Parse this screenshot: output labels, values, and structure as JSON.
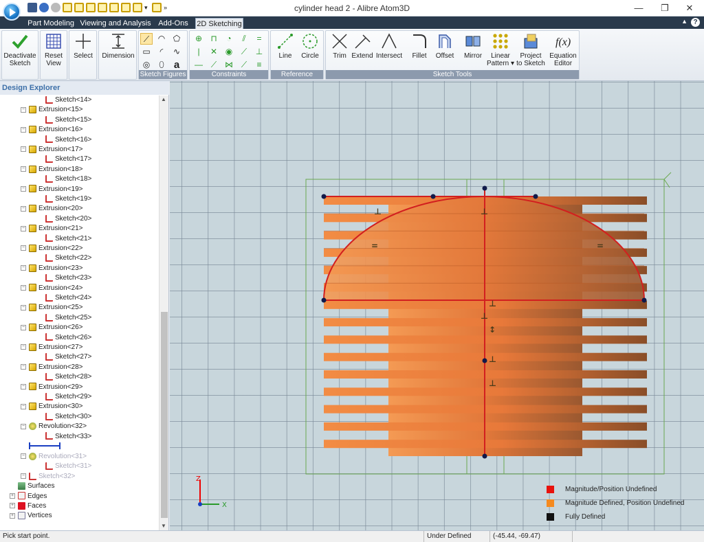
{
  "window": {
    "title": "cylinder head 2 - Alibre Atom3D",
    "minimize": "—",
    "maximize": "❐",
    "close": "✕"
  },
  "tabs": [
    {
      "label": "Part Modeling",
      "active": false
    },
    {
      "label": "Viewing and Analysis",
      "active": false
    },
    {
      "label": "Add-Ons",
      "active": false
    },
    {
      "label": "2D Sketching",
      "active": true
    }
  ],
  "ribbon": {
    "deactivate": {
      "line1": "Deactivate",
      "line2": "Sketch"
    },
    "reset_view": {
      "line1": "Reset",
      "line2": "View"
    },
    "select": {
      "label": "Select"
    },
    "dimension": {
      "label": "Dimension"
    },
    "sketch_figures_label": "Sketch Figures",
    "constraints_label": "Constraints",
    "line": {
      "label": "Line"
    },
    "circle": {
      "label": "Circle"
    },
    "reference_label": "Reference",
    "trim": {
      "label": "Trim"
    },
    "extend": {
      "label": "Extend"
    },
    "intersect": {
      "label": "Intersect"
    },
    "fillet": {
      "label": "Fillet"
    },
    "offset": {
      "label": "Offset"
    },
    "mirror": {
      "label": "Mirror"
    },
    "linear_pattern": {
      "line1": "Linear",
      "line2": "Pattern ▾"
    },
    "project": {
      "line1": "Project",
      "line2": "to Sketch"
    },
    "equation": {
      "line1": "Equation",
      "line2": "Editor"
    },
    "sketch_tools_label": "Sketch Tools"
  },
  "explorer": {
    "title": "Design Explorer",
    "items": [
      {
        "label": "Sketch<14>",
        "kind": "sketch",
        "state": "normal"
      },
      {
        "label": "Extrusion<15>",
        "kind": "extrusion",
        "state": "normal"
      },
      {
        "label": "Sketch<15>",
        "kind": "sketch",
        "state": "normal"
      },
      {
        "label": "Extrusion<16>",
        "kind": "extrusion",
        "state": "normal"
      },
      {
        "label": "Sketch<16>",
        "kind": "sketch",
        "state": "normal"
      },
      {
        "label": "Extrusion<17>",
        "kind": "extrusion",
        "state": "normal"
      },
      {
        "label": "Sketch<17>",
        "kind": "sketch",
        "state": "normal"
      },
      {
        "label": "Extrusion<18>",
        "kind": "extrusion",
        "state": "normal"
      },
      {
        "label": "Sketch<18>",
        "kind": "sketch",
        "state": "normal"
      },
      {
        "label": "Extrusion<19>",
        "kind": "extrusion",
        "state": "normal"
      },
      {
        "label": "Sketch<19>",
        "kind": "sketch",
        "state": "normal"
      },
      {
        "label": "Extrusion<20>",
        "kind": "extrusion",
        "state": "normal"
      },
      {
        "label": "Sketch<20>",
        "kind": "sketch",
        "state": "normal"
      },
      {
        "label": "Extrusion<21>",
        "kind": "extrusion",
        "state": "normal"
      },
      {
        "label": "Sketch<21>",
        "kind": "sketch",
        "state": "normal"
      },
      {
        "label": "Extrusion<22>",
        "kind": "extrusion",
        "state": "normal"
      },
      {
        "label": "Sketch<22>",
        "kind": "sketch",
        "state": "normal"
      },
      {
        "label": "Extrusion<23>",
        "kind": "extrusion",
        "state": "normal"
      },
      {
        "label": "Sketch<23>",
        "kind": "sketch",
        "state": "normal"
      },
      {
        "label": "Extrusion<24>",
        "kind": "extrusion",
        "state": "normal"
      },
      {
        "label": "Sketch<24>",
        "kind": "sketch",
        "state": "normal"
      },
      {
        "label": "Extrusion<25>",
        "kind": "extrusion",
        "state": "normal"
      },
      {
        "label": "Sketch<25>",
        "kind": "sketch",
        "state": "normal"
      },
      {
        "label": "Extrusion<26>",
        "kind": "extrusion",
        "state": "normal"
      },
      {
        "label": "Sketch<26>",
        "kind": "sketch",
        "state": "normal"
      },
      {
        "label": "Extrusion<27>",
        "kind": "extrusion",
        "state": "normal"
      },
      {
        "label": "Sketch<27>",
        "kind": "sketch",
        "state": "normal"
      },
      {
        "label": "Extrusion<28>",
        "kind": "extrusion",
        "state": "normal"
      },
      {
        "label": "Sketch<28>",
        "kind": "sketch",
        "state": "normal"
      },
      {
        "label": "Extrusion<29>",
        "kind": "extrusion",
        "state": "normal"
      },
      {
        "label": "Sketch<29>",
        "kind": "sketch",
        "state": "normal"
      },
      {
        "label": "Extrusion<30>",
        "kind": "extrusion",
        "state": "normal"
      },
      {
        "label": "Sketch<30>",
        "kind": "sketch",
        "state": "normal"
      },
      {
        "label": "Revolution<32>",
        "kind": "revolution",
        "state": "normal"
      },
      {
        "label": "Sketch<33>",
        "kind": "sketch",
        "state": "normal"
      },
      {
        "label": "",
        "kind": "rollback",
        "state": "normal"
      },
      {
        "label": "Revolution<31>",
        "kind": "revolution",
        "state": "dim"
      },
      {
        "label": "Sketch<31>",
        "kind": "sketch",
        "state": "dim"
      },
      {
        "label": "Sketch<32>",
        "kind": "sketch",
        "state": "dim"
      },
      {
        "label": "Surfaces",
        "kind": "surfaces",
        "state": "normal"
      },
      {
        "label": "Edges",
        "kind": "edges",
        "state": "normal"
      },
      {
        "label": "Faces",
        "kind": "faces",
        "state": "normal"
      },
      {
        "label": "Vertices",
        "kind": "vertices",
        "state": "normal"
      }
    ]
  },
  "legend": [
    {
      "label": "Magnitude/Position Undefined",
      "color": "#e8120c"
    },
    {
      "label": "Magnitude Defined, Position Undefined",
      "color": "#f58a1f"
    },
    {
      "label": "Fully Defined",
      "color": "#111111"
    }
  ],
  "axes": {
    "z": "Z",
    "x": "X"
  },
  "status": {
    "hint": "Pick start point.",
    "state": "Under Defined",
    "coords": "(-45.44, -69.47)"
  },
  "colors": {
    "accent": "#2a3a4c",
    "fin": "#e8793a",
    "sketch_line": "#d21f1f"
  }
}
